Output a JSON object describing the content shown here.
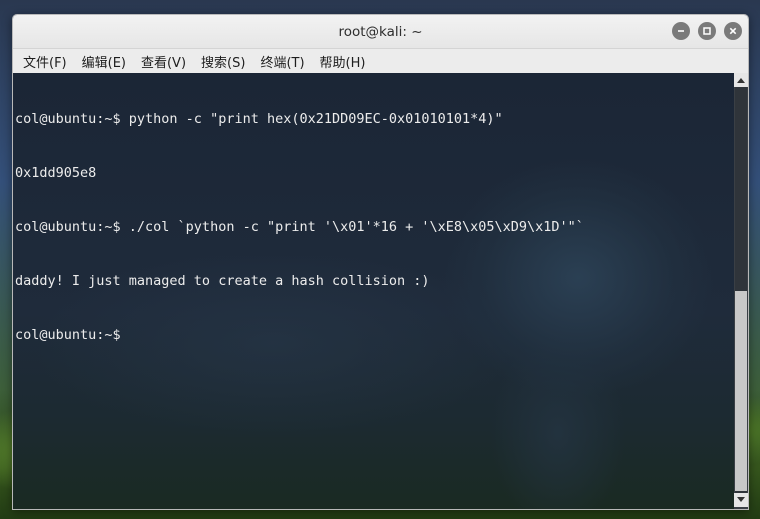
{
  "window": {
    "title": "root@kali: ~",
    "buttons": [
      "minimize-icon",
      "maximize-icon",
      "close-icon"
    ]
  },
  "menu": {
    "items": [
      {
        "id": "file",
        "label": "文件(F)"
      },
      {
        "id": "edit",
        "label": "编辑(E)"
      },
      {
        "id": "view",
        "label": "查看(V)"
      },
      {
        "id": "search",
        "label": "搜索(S)"
      },
      {
        "id": "terminal",
        "label": "终端(T)"
      },
      {
        "id": "help",
        "label": "帮助(H)"
      }
    ]
  },
  "terminal": {
    "lines": [
      "col@ubuntu:~$ python -c \"print hex(0x21DD09EC-0x01010101*4)\"",
      "0x1dd905e8",
      "col@ubuntu:~$ ./col `python -c \"print '\\x01'*16 + '\\xE8\\x05\\xD9\\x1D'\"`",
      "daddy! I just managed to create a hash collision :)",
      "col@ubuntu:~$ "
    ]
  },
  "colors": {
    "titlebar": "#ececec",
    "terminal_text": "#ececec",
    "wm_button": "#7a7a7a"
  }
}
